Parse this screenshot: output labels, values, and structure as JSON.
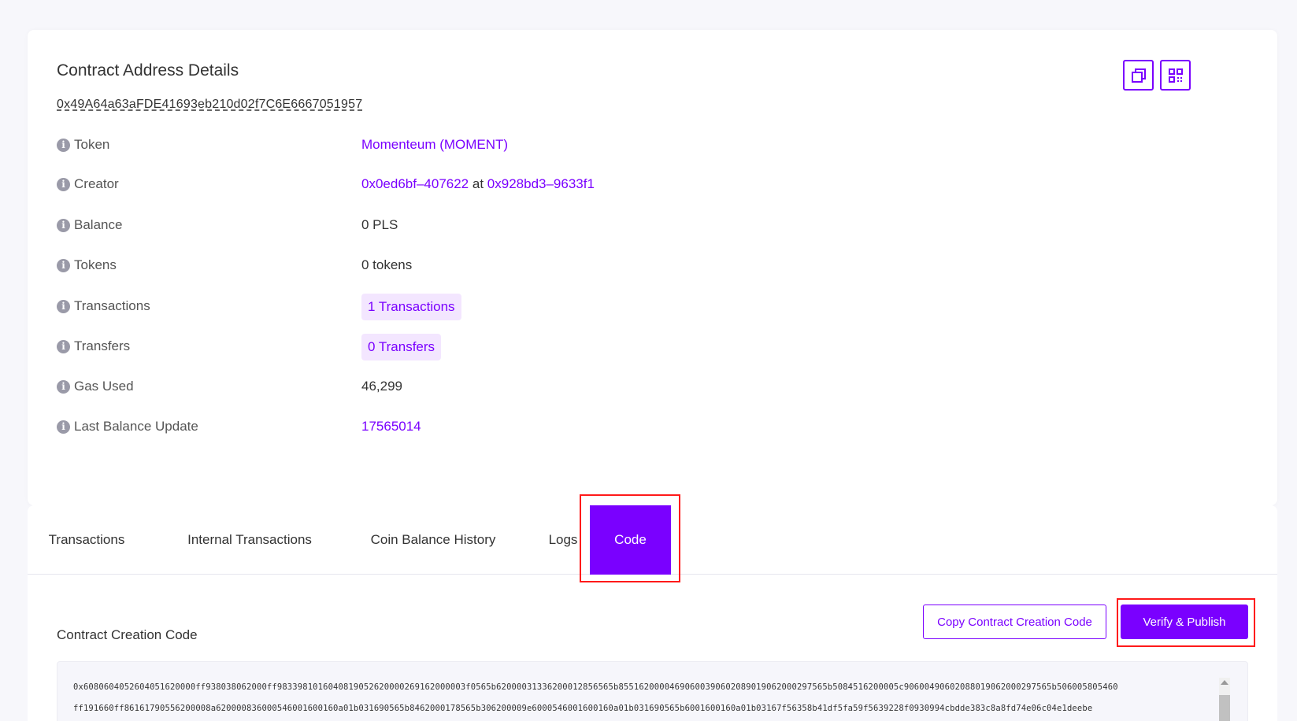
{
  "details": {
    "title": "Contract Address Details",
    "address": "0x49A64a63aFDE41693eb210d02f7C6E6667051957",
    "rows": [
      {
        "label": "Token",
        "value": "Momenteum (MOMENT)"
      },
      {
        "label": "Creator",
        "creator_addr": "0x0ed6bf–407622",
        "at": "at",
        "creator_tx": "0x928bd3–9633f1"
      },
      {
        "label": "Balance",
        "value": "0 PLS"
      },
      {
        "label": "Tokens",
        "value": "0 tokens"
      },
      {
        "label": "Transactions",
        "value": "1 Transactions"
      },
      {
        "label": "Transfers",
        "value": "0 Transfers"
      },
      {
        "label": "Gas Used",
        "value": "46,299"
      },
      {
        "label": "Last Balance Update",
        "value": "17565014"
      }
    ],
    "copy_icon": "copy-icon",
    "qr_icon": "qr-code-icon"
  },
  "tabs": [
    {
      "label": "Transactions"
    },
    {
      "label": "Internal Transactions"
    },
    {
      "label": "Coin Balance History"
    },
    {
      "label": "Logs"
    },
    {
      "label": "Code",
      "active": true
    }
  ],
  "code": {
    "section_title": "Contract Creation Code",
    "copy_button": "Copy Contract Creation Code",
    "verify_button": "Verify & Publish",
    "lines": [
      "0x6080604052604051620000ff938038062000ff9833981016040819052620000269162000003f0565b62000031336200012856565b85516200004690600390602089019062000297565b5084516200005c90600490602088019062000297565b506005805460",
      "ff191660ff86161790556200008a620000836000546001600160a01b031690565b8462000178565b306200009e6000546001600160a01b031690565b6001600160a01b03167f56358b41df5fa59f5639228f0930994cbdde383c8a8fd74e06c04e1deebe"
    ]
  },
  "colors": {
    "accent": "#7a00ff",
    "highlight": "#ff1a1a"
  }
}
